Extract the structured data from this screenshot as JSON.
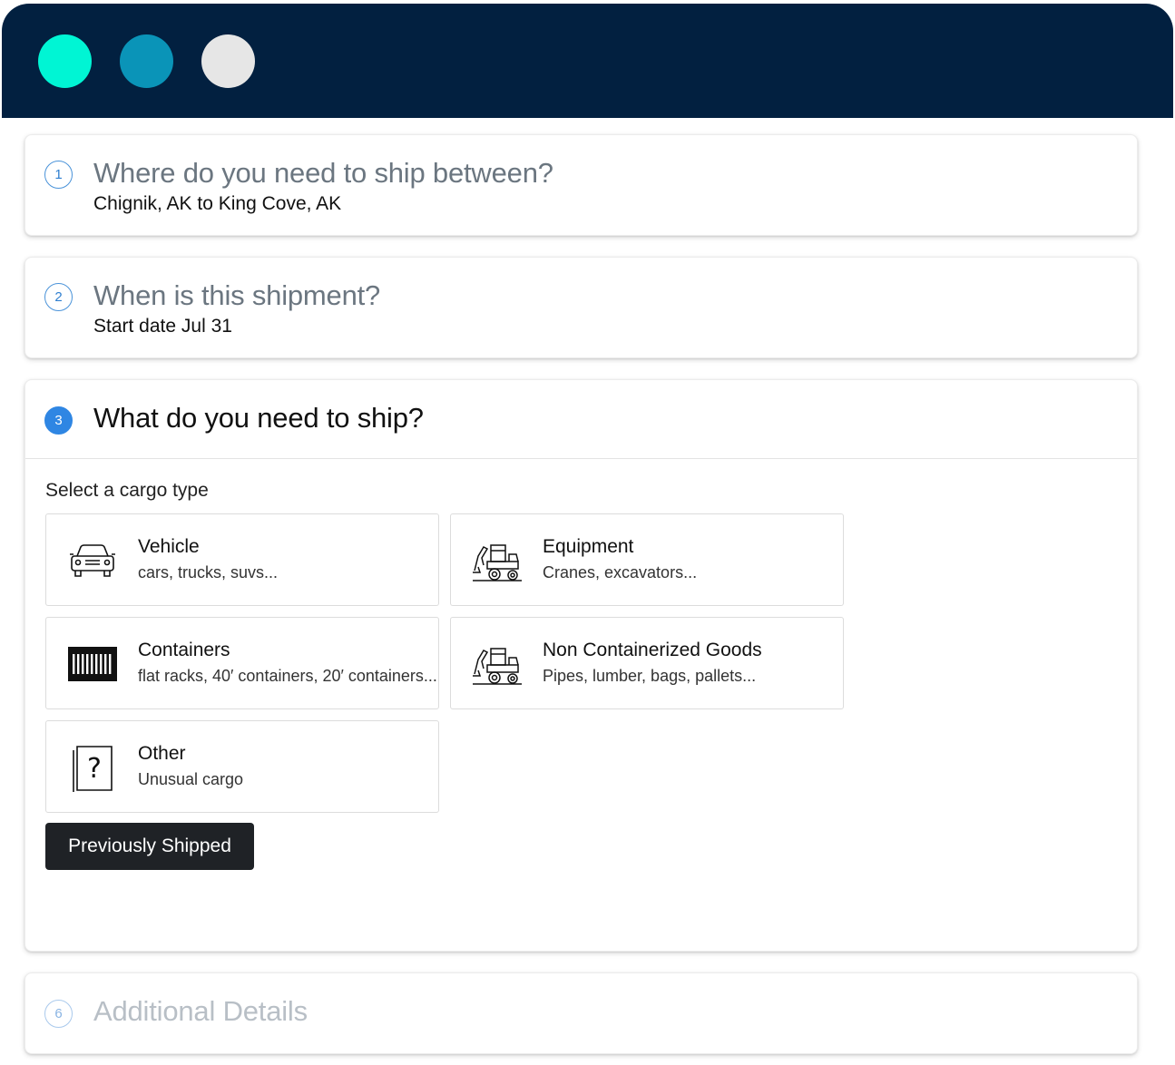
{
  "window": {
    "dots": [
      {
        "name": "teal",
        "color": "#00f5d4"
      },
      {
        "name": "blue",
        "color": "#0a94b8"
      },
      {
        "name": "gray",
        "color": "#e6e6e6"
      }
    ]
  },
  "steps": [
    {
      "number": "1",
      "title": "Where do you need to ship between?",
      "subtitle": "Chignik, AK to King Cove, AK"
    },
    {
      "number": "2",
      "title": "When is this shipment?",
      "subtitle": "Start date Jul 31"
    },
    {
      "number": "3",
      "title": "What do you need to ship?"
    },
    {
      "number": "6",
      "title": "Additional Details"
    }
  ],
  "cargo_section": {
    "label": "Select a cargo type",
    "options": [
      {
        "name": "Vehicle",
        "desc": "cars, trucks, suvs...",
        "icon": "car-icon"
      },
      {
        "name": "Equipment",
        "desc": "Cranes, excavators...",
        "icon": "excavator-icon"
      },
      {
        "name": "Containers",
        "desc": "flat racks, 40′ containers, 20′ containers...",
        "icon": "container-icon"
      },
      {
        "name": "Non Containerized Goods",
        "desc": "Pipes, lumber, bags, pallets...",
        "icon": "excavator-icon"
      },
      {
        "name": "Other",
        "desc": "Unusual cargo",
        "icon": "question-box-icon"
      }
    ],
    "previously_shipped_label": "Previously Shipped"
  }
}
